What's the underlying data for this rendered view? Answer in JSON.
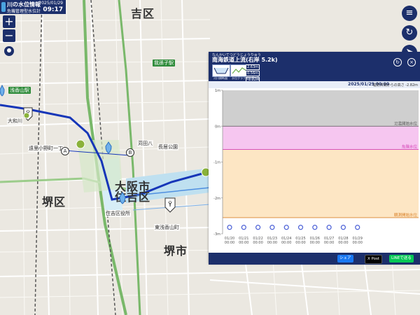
{
  "header": {
    "title": "川の水位情報",
    "subtitle": "危機管理型水位計",
    "date": "2025/01/29",
    "time": "09:17"
  },
  "map": {
    "wards": [
      "吉区",
      "大阪市",
      "住吉区",
      "堺区",
      "堺市"
    ],
    "labels": [
      "浅香山駅",
      "我孫子駅",
      "長居公園",
      "苅田八",
      "住吉区役所",
      "東浅香山町",
      "遠里小野町一丁",
      "大和川"
    ],
    "markers": [
      "A",
      "B"
    ]
  },
  "panel": {
    "kana": "なんかいてつどうじょうりゅう",
    "station_name": "南海鉄道上流(右岸 5.2k)",
    "tabs": [
      "河川横断図",
      "水位グラフ",
      "観測値一覧"
    ],
    "levels": [
      "2.63m",
      "0.56m",
      "-1.22m"
    ],
    "info_datetime": "2025/01/29 00:00",
    "zero_level": "堤防天端からの高さ -2.82m",
    "share_labels": [
      "シェア",
      "X Post",
      "LINEで送る"
    ]
  },
  "chart_data": {
    "type": "line",
    "y_ticks": [
      "1m",
      "0m",
      "-1m",
      "-2m",
      "-3m"
    ],
    "ylim": [
      -3,
      1
    ],
    "x": [
      "01/20",
      "01/21",
      "01/22",
      "01/23",
      "01/24",
      "01/25",
      "01/26",
      "01/27",
      "01/28",
      "01/29"
    ],
    "x_sub": [
      "00:00",
      "00:00",
      "00:00",
      "00:00",
      "00:00",
      "00:00",
      "00:00",
      "00:00",
      "00:00",
      "00:00"
    ],
    "series": [
      {
        "values": [
          -2.82,
          -2.82,
          -2.82,
          -2.82,
          -2.82,
          -2.82,
          -2.82,
          -2.82,
          -2.82,
          -2.82
        ]
      }
    ],
    "bands": [
      {
        "label": "氾濫開始水位",
        "from": 0,
        "to": 1,
        "color": "#cfcfcf"
      },
      {
        "label": "危険水位",
        "from": -0.65,
        "to": 0,
        "color": "#f6c6f0"
      },
      {
        "label": "観測開始水位",
        "from": -2.55,
        "to": -0.65,
        "color": "#fde6c4"
      }
    ],
    "band_text_colors": [
      "#555555",
      "#d43fb5",
      "#d9822b"
    ],
    "point_color": "#4a5fd6"
  }
}
